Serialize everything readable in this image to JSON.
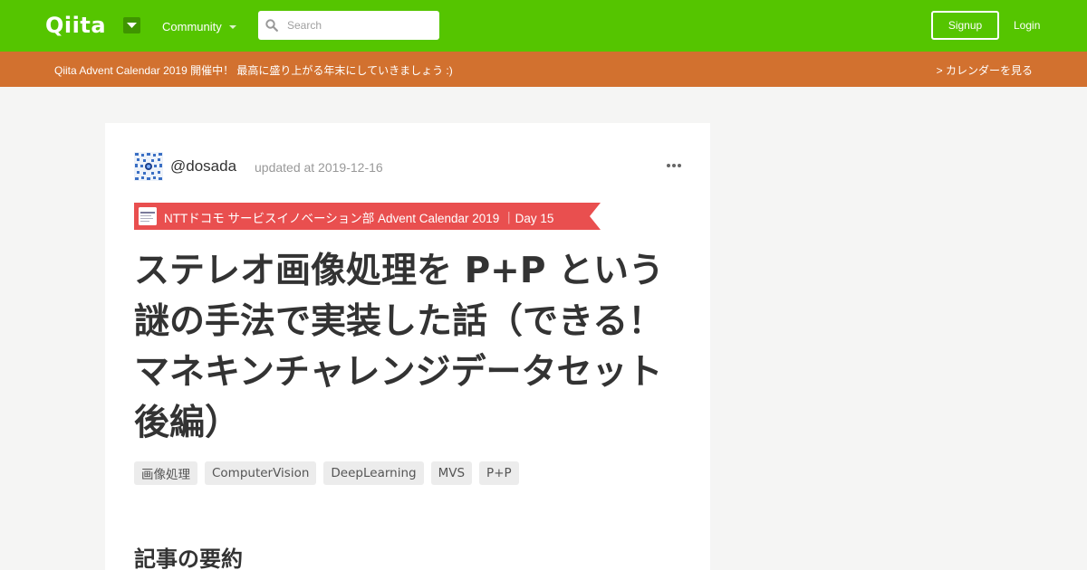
{
  "header": {
    "logo_text": "Qiita",
    "community_label": "Community",
    "search_placeholder": "Search",
    "signup_label": "Signup",
    "login_label": "Login",
    "colors": {
      "brand": "#55c500",
      "brand_dark": "#3f9500"
    }
  },
  "banner": {
    "text": "Qiita Advent Calendar 2019 開催中！ 最高に盛り上がる年末にしていきましょう :)",
    "link_label": "> カレンダーを見る",
    "color": "#d2712f"
  },
  "article": {
    "author": "@dosada",
    "updated": "updated at 2019-12-16",
    "advent_label": "NTTドコモ サービスイノベーション部 Advent Calendar 2019 ｜Day 15",
    "advent_color": "#e94f4f",
    "title": "ステレオ画像処理を P+P という謎の手法で実装した話（できる！マネキンチャレンジデータセット 後編）",
    "tags": [
      "画像処理",
      "ComputerVision",
      "DeepLearning",
      "MVS",
      "P+P"
    ],
    "section_heading": "記事の要約"
  },
  "icons": {
    "search": "search-icon",
    "dropdown": "caret-down-icon",
    "more": "more-dots-icon",
    "avatar": "user-avatar",
    "advent_logo": "docomo-logo"
  }
}
